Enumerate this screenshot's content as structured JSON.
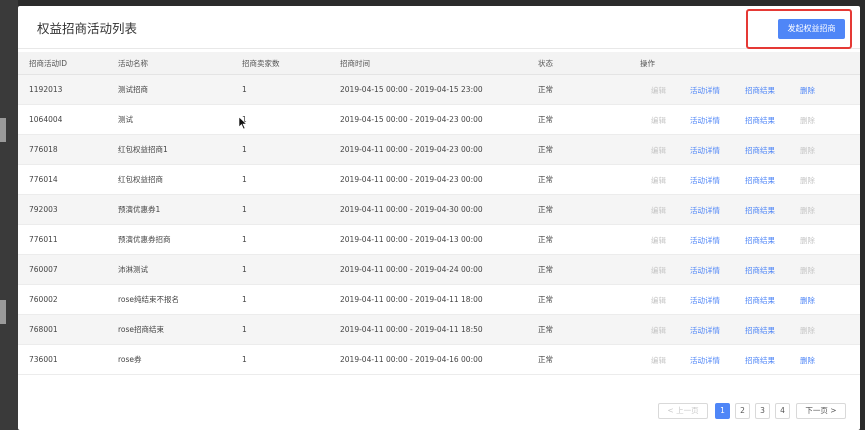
{
  "page": {
    "title": "权益招商活动列表",
    "create_button": "发起权益招商"
  },
  "colors": {
    "accent": "#4f86f7",
    "highlight": "#e53935",
    "disabled": "#c6c6c6"
  },
  "table": {
    "columns": [
      "招商活动ID",
      "活动名称",
      "招商卖家数",
      "招商时间",
      "状态",
      "操作"
    ],
    "rows": [
      {
        "id": "1192013",
        "name": "测试招商",
        "sellers": "1",
        "time": "2019-04-15 00:00 - 2019-04-15 23:00",
        "status": "正常",
        "delete_enabled": true
      },
      {
        "id": "1064004",
        "name": "测试",
        "sellers": "1",
        "time": "2019-04-15 00:00 - 2019-04-23 00:00",
        "status": "正常",
        "delete_enabled": false
      },
      {
        "id": "776018",
        "name": "红包权益招商1",
        "sellers": "1",
        "time": "2019-04-11 00:00 - 2019-04-23 00:00",
        "status": "正常",
        "delete_enabled": false
      },
      {
        "id": "776014",
        "name": "红包权益招商",
        "sellers": "1",
        "time": "2019-04-11 00:00 - 2019-04-23 00:00",
        "status": "正常",
        "delete_enabled": false
      },
      {
        "id": "792003",
        "name": "预演优惠券1",
        "sellers": "1",
        "time": "2019-04-11 00:00 - 2019-04-30 00:00",
        "status": "正常",
        "delete_enabled": false
      },
      {
        "id": "776011",
        "name": "预演优惠券招商",
        "sellers": "1",
        "time": "2019-04-11 00:00 - 2019-04-13 00:00",
        "status": "正常",
        "delete_enabled": false
      },
      {
        "id": "760007",
        "name": "沛淋测试",
        "sellers": "1",
        "time": "2019-04-11 00:00 - 2019-04-24 00:00",
        "status": "正常",
        "delete_enabled": false
      },
      {
        "id": "760002",
        "name": "rose纯结束不报名",
        "sellers": "1",
        "time": "2019-04-11 00:00 - 2019-04-11 18:00",
        "status": "正常",
        "delete_enabled": true
      },
      {
        "id": "768001",
        "name": "rose招商结束",
        "sellers": "1",
        "time": "2019-04-11 00:00 - 2019-04-11 18:50",
        "status": "正常",
        "delete_enabled": false
      },
      {
        "id": "736001",
        "name": "rose券",
        "sellers": "1",
        "time": "2019-04-11 00:00 - 2019-04-16 00:00",
        "status": "正常",
        "delete_enabled": true
      }
    ],
    "actions": {
      "edit": "编辑",
      "detail": "活动详情",
      "result": "招商结果",
      "delete": "删除"
    }
  },
  "pagination": {
    "prev": "< 上一页",
    "next": "下一页 >",
    "pages": [
      "1",
      "2",
      "3",
      "4"
    ],
    "current": "1"
  }
}
